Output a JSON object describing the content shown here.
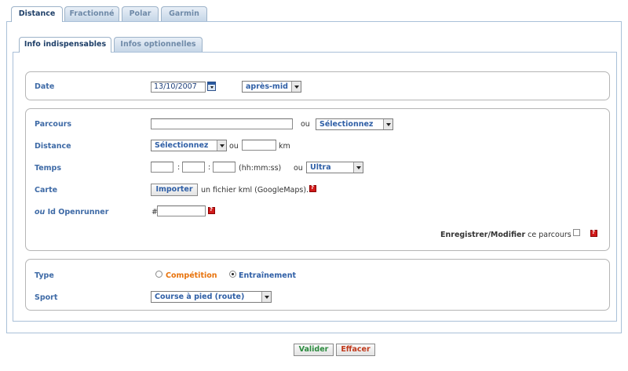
{
  "top_tabs": [
    "Distance",
    "Fractionné",
    "Polar",
    "Garmin"
  ],
  "sub_tabs": [
    "Info indispensables",
    "Infos optionnelles"
  ],
  "date": {
    "label": "Date",
    "value": "13/10/2007",
    "period": "après-mid"
  },
  "parcours": {
    "label": "Parcours",
    "value": "",
    "or": "ou",
    "select": "Sélectionnez"
  },
  "distance": {
    "label": "Distance",
    "select": "Sélectionnez",
    "or": "ou",
    "value": "",
    "unit": "km"
  },
  "temps": {
    "label": "Temps",
    "hh": "",
    "mm": "",
    "ss": "",
    "sep1": ":",
    "sep2": ":",
    "format": "(hh:mm:ss)",
    "or": "ou",
    "select": "Ultra"
  },
  "carte": {
    "label": "Carte",
    "button": "Importer",
    "text": "un fichier kml (GoogleMaps)."
  },
  "openrunner": {
    "label_prefix": "ou",
    "label": "Id Openrunner",
    "hash": "#",
    "value": ""
  },
  "save_parcours": {
    "bold": "Enregistrer/Modifier",
    "text": "ce parcours",
    "checked": false
  },
  "type": {
    "label": "Type",
    "options": [
      "Compétition",
      "Entraînement"
    ],
    "selected": "Entraînement",
    "colors": {
      "competition": "#e8730c",
      "entrainement": "#2f5fa6"
    }
  },
  "sport": {
    "label": "Sport",
    "select": "Course à pied (route)"
  },
  "actions": {
    "validate": "Valider",
    "clear": "Effacer",
    "colors": {
      "validate": "#2b8a3e",
      "clear": "#c0391b"
    }
  },
  "colors": {
    "label": "#3e6aa6",
    "tab_active": "#1e3f68",
    "tab_inactive": "#6f8aa8",
    "border": "#a9c0d8",
    "help": "#d11a1a"
  }
}
